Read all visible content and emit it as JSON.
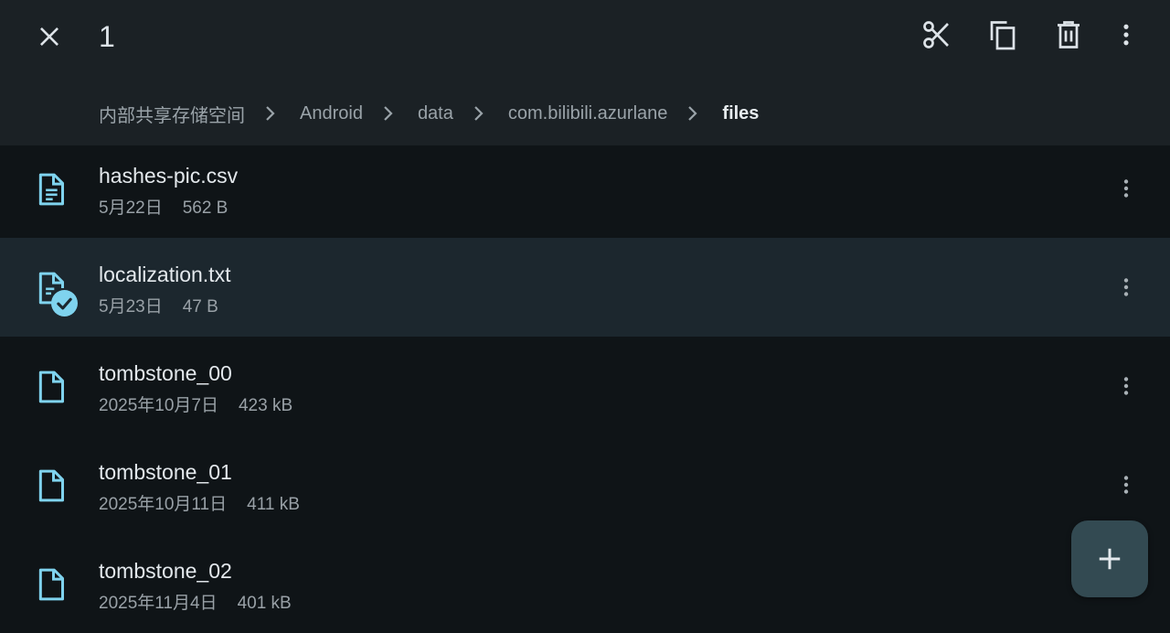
{
  "appbar": {
    "selected_count": "1",
    "actions": {
      "close": "close-icon",
      "cut": "cut-icon",
      "copy": "copy-icon",
      "delete": "delete-icon",
      "more": "more-vert-icon"
    }
  },
  "breadcrumb": [
    {
      "label": "内部共享存储空间"
    },
    {
      "label": "Android"
    },
    {
      "label": "data"
    },
    {
      "label": "com.bilibili.azurlane"
    },
    {
      "label": "files"
    }
  ],
  "files": [
    {
      "name": "hashes-pic.csv",
      "date": "5月22日",
      "size": "562 B",
      "icon": "text-file-icon",
      "selected": false
    },
    {
      "name": "localization.txt",
      "date": "5月23日",
      "size": "47 B",
      "icon": "text-file-icon",
      "selected": true
    },
    {
      "name": "tombstone_00",
      "date": "2025年10月7日",
      "size": "423 kB",
      "icon": "file-icon",
      "selected": false
    },
    {
      "name": "tombstone_01",
      "date": "2025年10月11日",
      "size": "411 kB",
      "icon": "file-icon",
      "selected": false
    },
    {
      "name": "tombstone_02",
      "date": "2025年11月4日",
      "size": "401 kB",
      "icon": "file-icon",
      "selected": false
    }
  ],
  "fab": {
    "icon": "add-icon"
  },
  "colors": {
    "accent": "#7fd3ee",
    "appbar_bg": "#1b2125",
    "list_bg": "#0f1417",
    "selected_row_bg": "#1c272e",
    "fab_bg": "#334a52"
  }
}
